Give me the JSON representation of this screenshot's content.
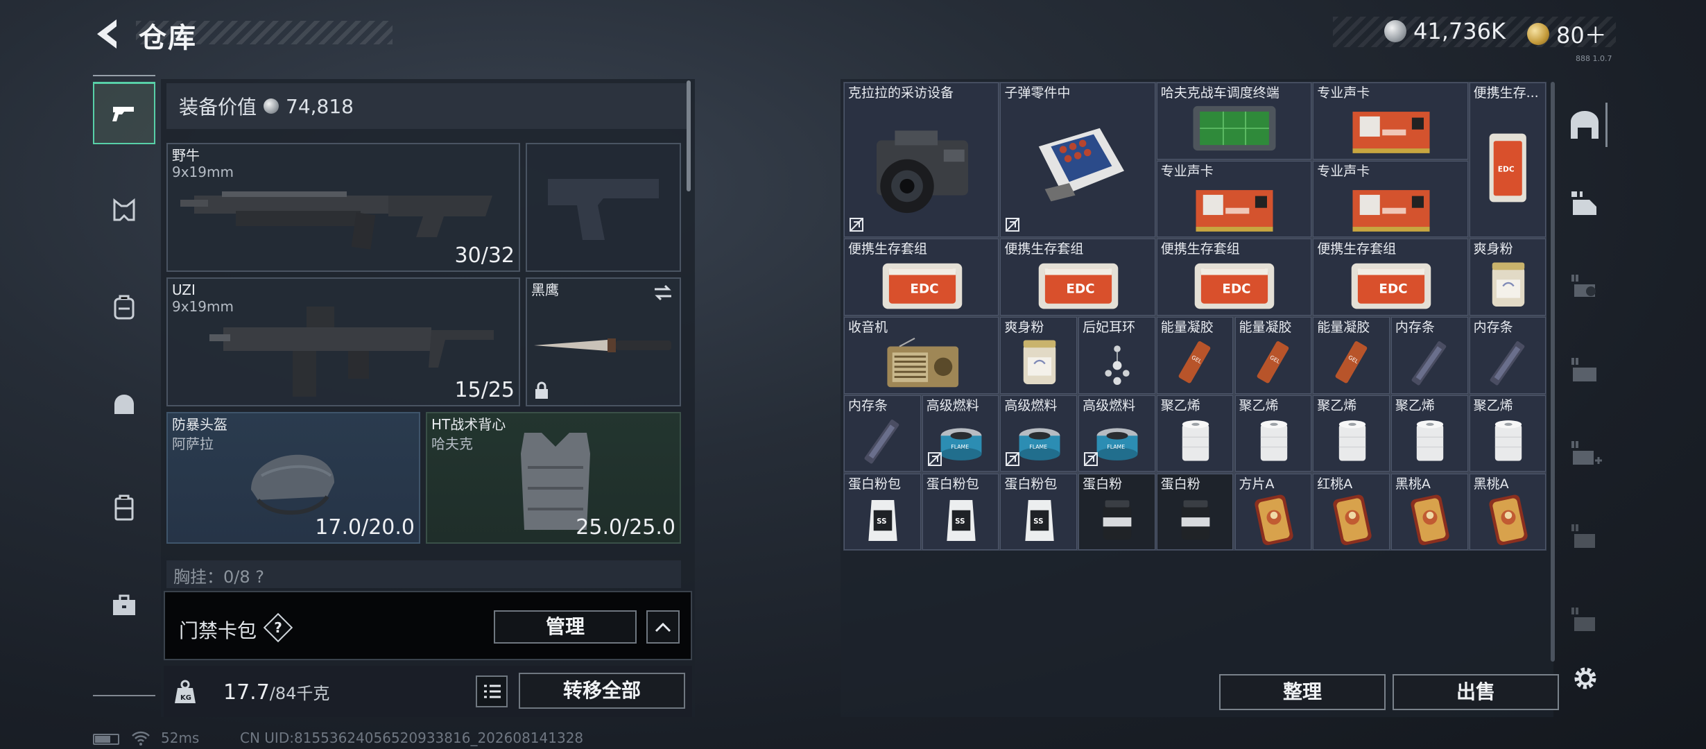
{
  "header": {
    "title": "仓库",
    "currency_silver": "41,736K",
    "currency_gold": "80＋",
    "version": "888 1.0.7"
  },
  "equipment": {
    "value_label": "装备价值",
    "value": "74,818",
    "slots": [
      {
        "name": "野牛",
        "sub": "9x19mm",
        "durability": "30/32"
      },
      {
        "name": "",
        "sub": "",
        "durability": ""
      },
      {
        "name": "UZI",
        "sub": "9x19mm",
        "durability": "15/25"
      },
      {
        "name": "黑鹰",
        "sub": "",
        "durability": ""
      },
      {
        "name": "防暴头盔",
        "sub": "阿萨拉",
        "durability": "17.0/20.0"
      },
      {
        "name": "HT战术背心",
        "sub": "哈夫克",
        "durability": "25.0/25.0"
      }
    ],
    "chest_row": "胸挂：0/8  ?",
    "card_bag": {
      "label": "门禁卡包",
      "help": "?",
      "manage": "管理"
    },
    "weight": {
      "current": "17.7",
      "max": "/84千克"
    },
    "transfer_all": "转移全部"
  },
  "warehouse": {
    "items": [
      {
        "name": "克拉拉的采访设备",
        "icon": "camera",
        "noswap": true
      },
      {
        "name": "子弹零件中",
        "icon": "parts-box",
        "noswap": true
      },
      {
        "name": "哈夫克战车调度终端",
        "icon": "terminal",
        "noswap": false
      },
      {
        "name": "专业声卡",
        "icon": "sound-card",
        "noswap": false
      },
      {
        "name": "便携生存...",
        "icon": "survival-kit-tall",
        "noswap": false
      },
      {
        "name": "专业声卡",
        "icon": "sound-card",
        "noswap": false
      },
      {
        "name": "专业声卡",
        "icon": "sound-card",
        "noswap": false
      },
      {
        "name": "便携生存套组",
        "icon": "survival-kit",
        "noswap": false
      },
      {
        "name": "便携生存套组",
        "icon": "survival-kit",
        "noswap": false
      },
      {
        "name": "便携生存套组",
        "icon": "survival-kit",
        "noswap": false
      },
      {
        "name": "便携生存套组",
        "icon": "survival-kit",
        "noswap": false
      },
      {
        "name": "爽身粉",
        "icon": "powder-can",
        "noswap": false
      },
      {
        "name": "收音机",
        "icon": "radio",
        "noswap": false
      },
      {
        "name": "爽身粉",
        "icon": "powder-can",
        "noswap": false
      },
      {
        "name": "后妃耳环",
        "icon": "earring",
        "noswap": false
      },
      {
        "name": "能量凝胶",
        "icon": "gel",
        "noswap": false
      },
      {
        "name": "能量凝胶",
        "icon": "gel",
        "noswap": false
      },
      {
        "name": "能量凝胶",
        "icon": "gel",
        "noswap": false
      },
      {
        "name": "内存条",
        "icon": "ram",
        "noswap": false
      },
      {
        "name": "内存条",
        "icon": "ram",
        "noswap": false
      },
      {
        "name": "内存条",
        "icon": "ram",
        "noswap": false
      },
      {
        "name": "高级燃料",
        "icon": "fuel-can",
        "noswap": true
      },
      {
        "name": "高级燃料",
        "icon": "fuel-can",
        "noswap": true
      },
      {
        "name": "高级燃料",
        "icon": "fuel-can",
        "noswap": true
      },
      {
        "name": "聚乙烯",
        "icon": "poly-roll",
        "noswap": false
      },
      {
        "name": "聚乙烯",
        "icon": "poly-roll",
        "noswap": false
      },
      {
        "name": "聚乙烯",
        "icon": "poly-roll",
        "noswap": false
      },
      {
        "name": "聚乙烯",
        "icon": "poly-roll",
        "noswap": false
      },
      {
        "name": "聚乙烯",
        "icon": "poly-roll",
        "noswap": false
      },
      {
        "name": "蛋白粉包",
        "icon": "protein-bag",
        "noswap": false
      },
      {
        "name": "蛋白粉包",
        "icon": "protein-bag",
        "noswap": false
      },
      {
        "name": "蛋白粉包",
        "icon": "protein-bag",
        "noswap": false
      },
      {
        "name": "蛋白粉",
        "icon": "protein-jar",
        "noswap": false
      },
      {
        "name": "蛋白粉",
        "icon": "protein-jar",
        "noswap": false
      },
      {
        "name": "方片A",
        "icon": "card",
        "noswap": false
      },
      {
        "name": "红桃A",
        "icon": "card",
        "noswap": false
      },
      {
        "name": "黑桃A",
        "icon": "card",
        "noswap": false
      },
      {
        "name": "黑桃A",
        "icon": "card",
        "noswap": false
      }
    ],
    "tidy": "整理",
    "sell": "出售"
  },
  "status_bar": {
    "ping": "52ms",
    "uid": "CN UID:81553624056520933816_202608141328"
  },
  "colors": {
    "accent_green": "#58d0a8",
    "cell_bg": "#2a3142",
    "grid_line": "#4d566a"
  }
}
